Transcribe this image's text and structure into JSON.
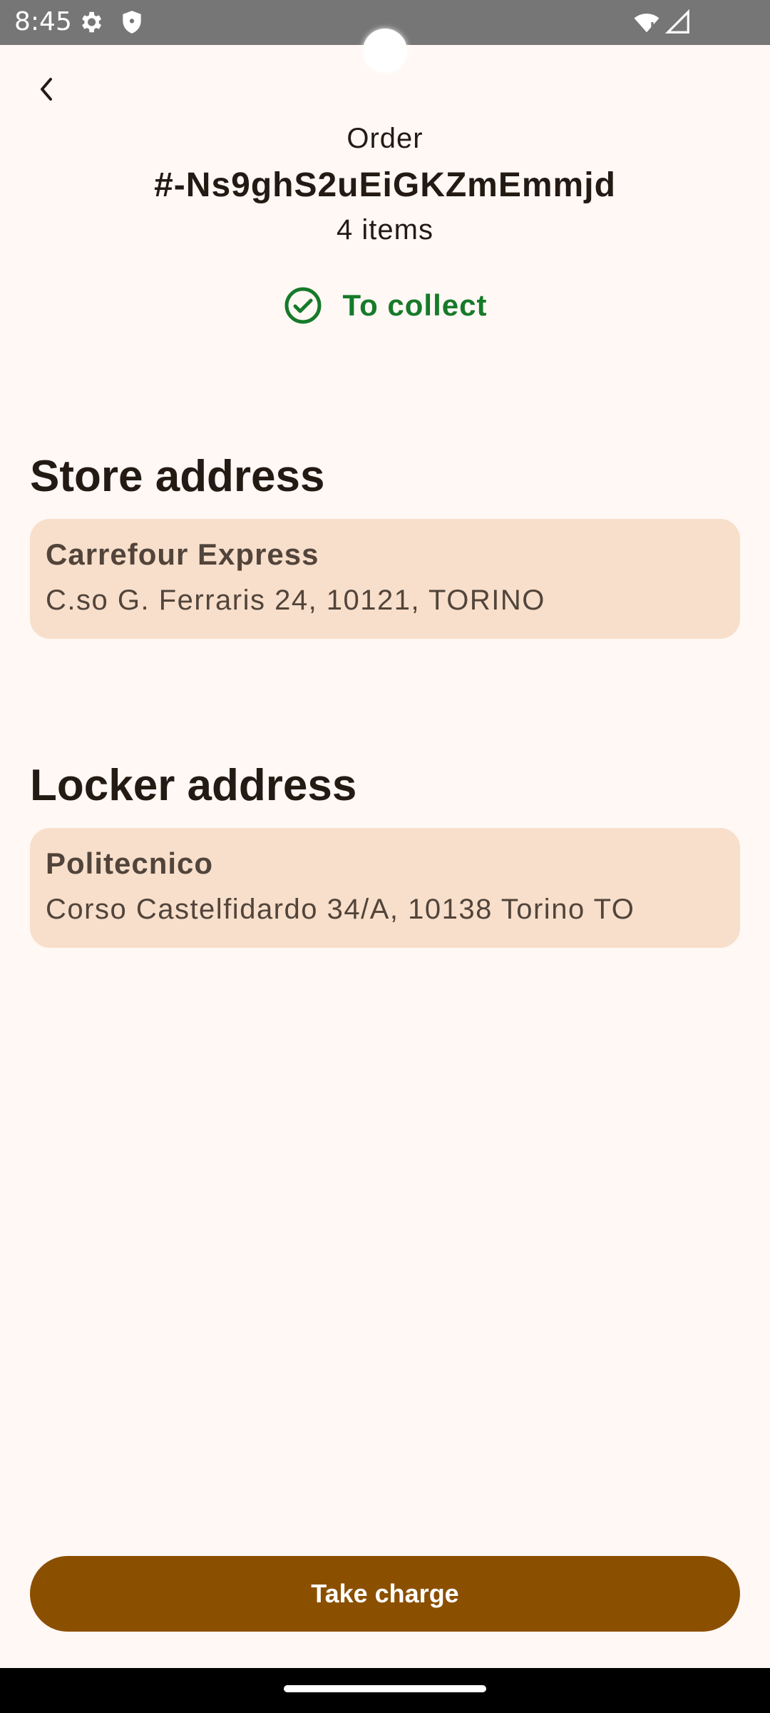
{
  "status_bar": {
    "time": "8:45",
    "icons": [
      "gear-icon",
      "shield-icon",
      "wifi-icon",
      "signal-icon"
    ]
  },
  "header": {
    "back_icon": "chevron-left-icon",
    "order_label": "Order",
    "order_id": "#-Ns9ghS2uEiGKZmEmmjd",
    "items_count": "4 items",
    "status": {
      "icon": "check-circle-icon",
      "label": "To collect",
      "color": "#167A2A"
    }
  },
  "store": {
    "section_title": "Store address",
    "name": "Carrefour Express",
    "address": "C.so G. Ferraris 24, 10121, TORINO"
  },
  "locker": {
    "section_title": "Locker address",
    "name": "Politecnico",
    "address": "Corso Castelfidardo 34/A, 10138 Torino TO"
  },
  "action": {
    "take_charge_label": "Take charge"
  },
  "colors": {
    "background": "#FFF8F5",
    "card": "#F7DFCB",
    "primary": "#8B4F00",
    "status_green": "#167A2A"
  }
}
